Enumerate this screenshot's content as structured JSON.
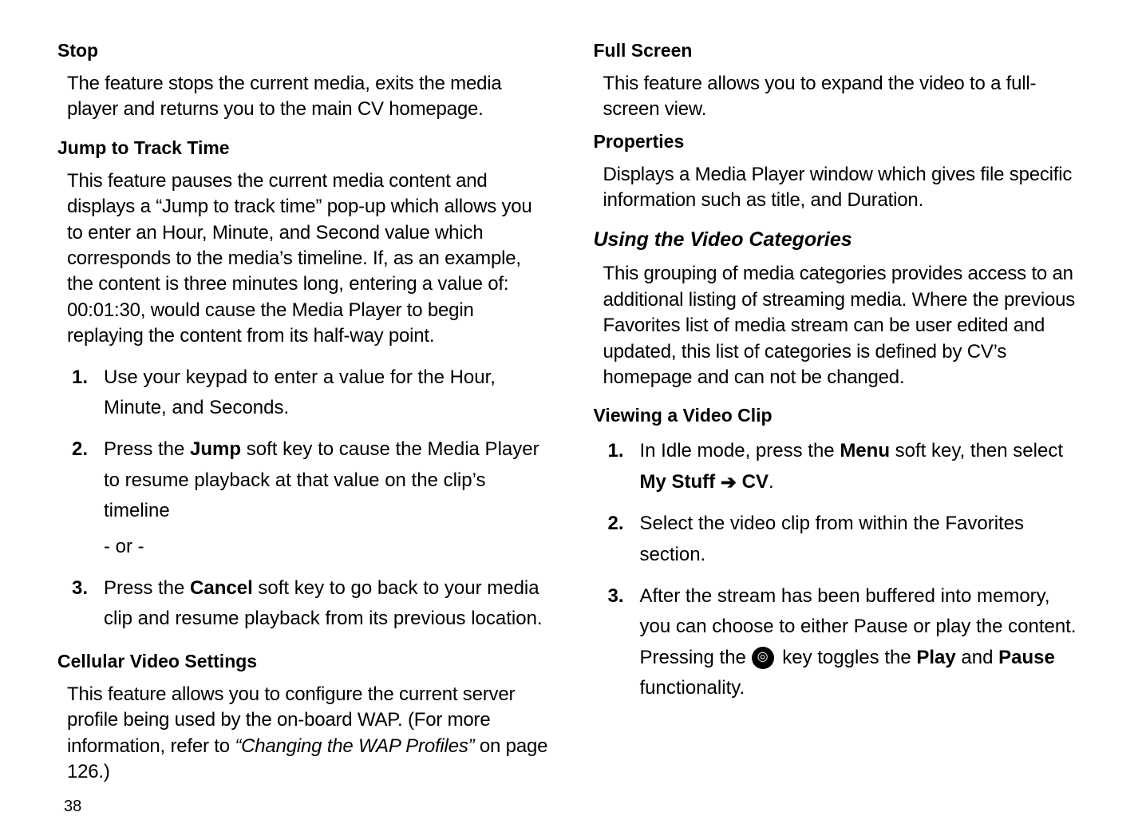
{
  "left": {
    "h_stop": "Stop",
    "p_stop": "The feature stops the current media, exits the media player and returns you to the main CV homepage.",
    "h_jump": "Jump to Track Time",
    "p_jump": "This feature pauses the current media content and displays a “Jump to track time” pop-up which allows you to enter an Hour, Minute, and Second value which corresponds to the media’s timeline. If, as an example, the content is three minutes long, entering a value of: 00:01:30, would cause the Media Player to begin replaying the content from its half-way point.",
    "steps": {
      "n1": "1.",
      "s1": "Use your keypad to enter a value for the Hour, Minute, and Seconds.",
      "n2": "2.",
      "s2a": "Press the ",
      "s2_jump": "Jump",
      "s2b": " soft key to cause the Media Player to resume playback at that value on the clip’s timeline",
      "s2_or": "- or -",
      "n3": "3.",
      "s3a": "Press the ",
      "s3_cancel": "Cancel",
      "s3b": " soft key to go back to your media clip and resume playback from its previous location."
    },
    "h_cvset": "Cellular Video Settings",
    "p_cvset_a": "This feature allows you to configure the current server profile being used by the on-board WAP. (For more information, refer to ",
    "p_cvset_ref": "“Changing the WAP Profiles” ",
    "p_cvset_b": " on page 126.)"
  },
  "right": {
    "h_full": "Full Screen",
    "p_full": "This feature allows you to expand the video to a full-screen view.",
    "h_props": "Properties",
    "p_props": "Displays a Media Player window which gives file specific information such as title, and Duration.",
    "h_cats": "Using the Video Categories",
    "p_cats": "This grouping of media categories provides access to an additional listing of streaming media. Where the previous Favorites list of media stream can be user edited and updated, this list of categories is defined by CV’s homepage and can not be changed.",
    "h_view": "Viewing a Video Clip",
    "steps": {
      "n1": "1.",
      "s1a": "In Idle mode, press the ",
      "s1_menu": "Menu",
      "s1b": " soft key, then select ",
      "s1_mystuff": "My Stuff ",
      "s1_arrow": "➔",
      "s1_cv": " CV",
      "s1_period": ".",
      "n2": "2.",
      "s2": "Select the video clip from within the Favorites section.",
      "n3": "3.",
      "s3a": "After the stream has been buffered into memory, you can choose to either Pause or play the content. Pressing the ",
      "s3b": " key toggles the ",
      "s3_play": "Play",
      "s3c": " and ",
      "s3_pause": "Pause",
      "s3d": " functionality."
    }
  },
  "key_glyph": "◎",
  "page_number": "38"
}
